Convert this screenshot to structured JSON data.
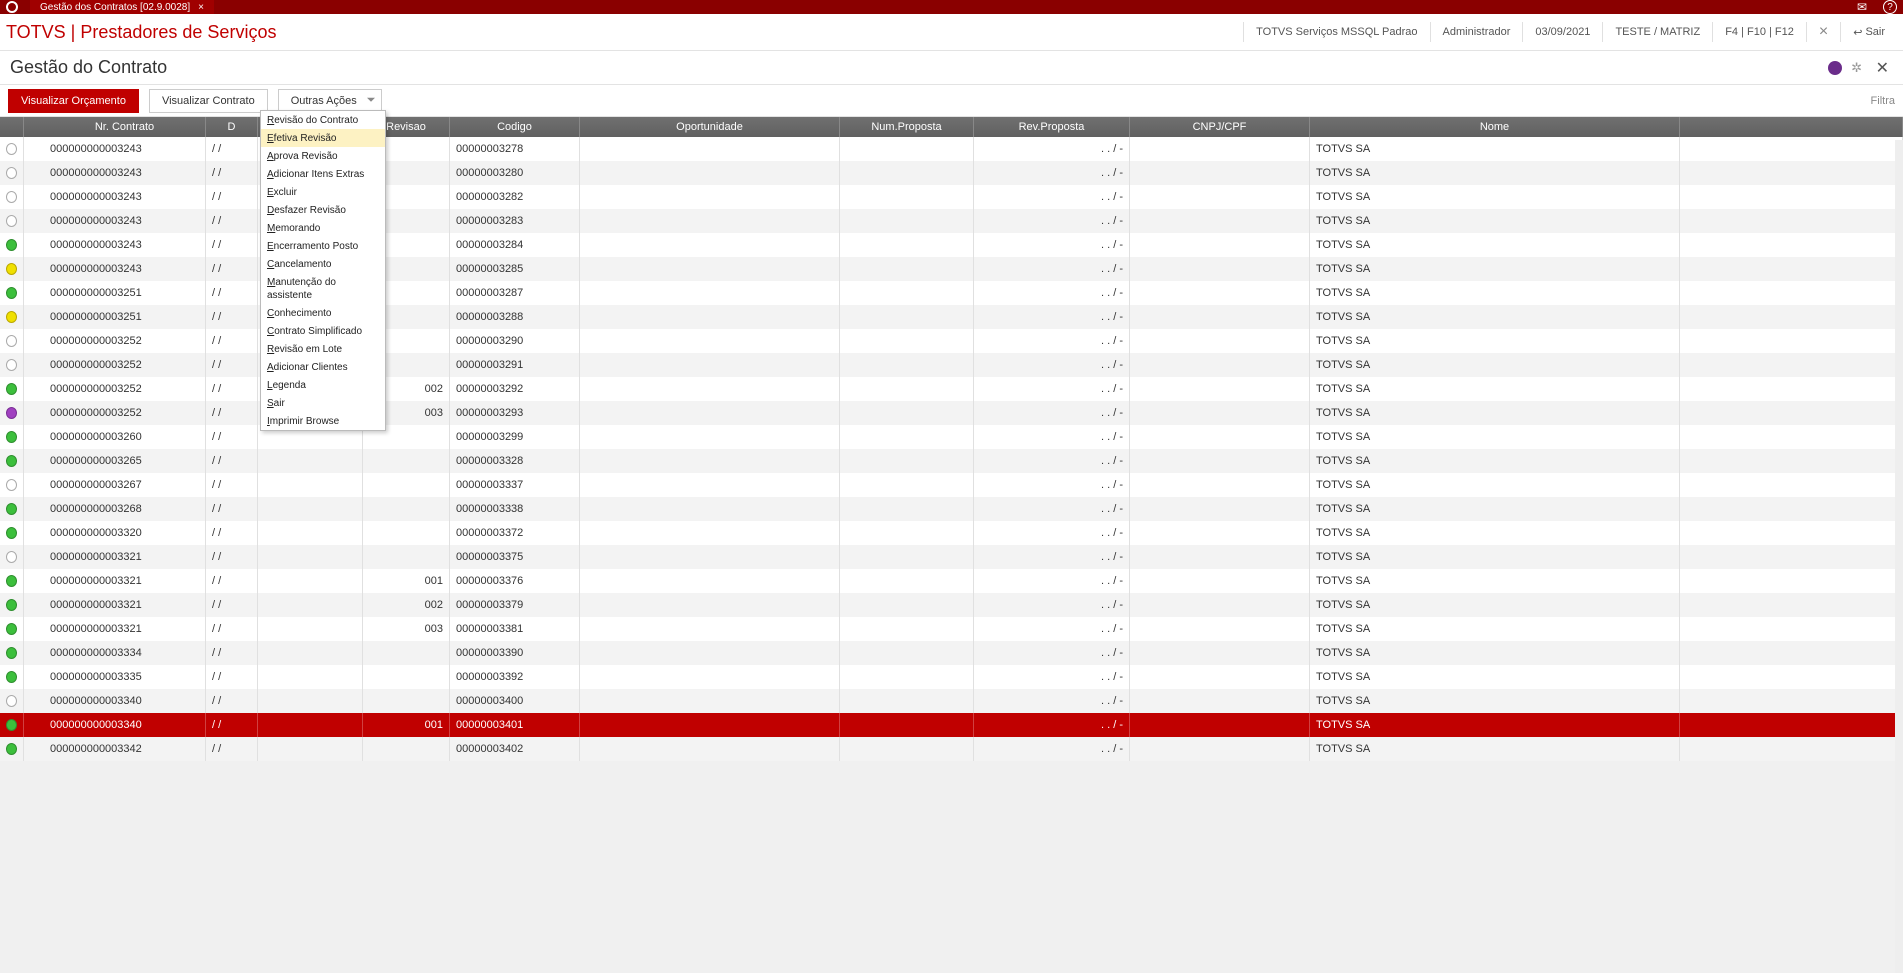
{
  "titlebar": {
    "tab_label": "Gestão dos Contratos [02.9.0028]"
  },
  "header": {
    "brand": "TOTVS | Prestadores de Serviços",
    "env": "TOTVS Serviços MSSQL Padrao",
    "user": "Administrador",
    "date": "03/09/2021",
    "org": "TESTE / MATRIZ",
    "shortcuts": "F4 | F10 | F12",
    "exit": "Sair"
  },
  "page": {
    "title": "Gestão do Contrato"
  },
  "toolbar": {
    "visualizar_orcamento": "Visualizar Orçamento",
    "visualizar_contrato": "Visualizar Contrato",
    "outras_acoes": "Outras Ações",
    "filtrar": "Filtra"
  },
  "dropdown": {
    "items": [
      "Revisão do Contrato",
      "Efetiva Revisão",
      "Aprova Revisão",
      "Adicionar Itens Extras",
      "Excluir",
      "Desfazer Revisão",
      "Memorando",
      "Encerramento Posto",
      "Cancelamento",
      "Manutenção do assistente",
      "Conhecimento",
      "Contrato Simplificado",
      "Revisão em Lote",
      "Adicionar Clientes",
      "Legenda",
      "Sair",
      "Imprimir Browse"
    ],
    "highlight_index": 1
  },
  "columns": {
    "status": "",
    "nr": "Nr. Contrato",
    "dt": "D",
    "rev": "Revisao",
    "cod": "Codigo",
    "opo": "Oportunidade",
    "np": "Num.Proposta",
    "rp": "Rev.Proposta",
    "cnpj": "CNPJ/CPF",
    "nome": "Nome"
  },
  "rows": [
    {
      "st": "white",
      "nr": "000000000003243",
      "dt": "/  /",
      "rev": "",
      "cod": "00000003278",
      "rp": ".  .   /    -",
      "nome": "TOTVS SA"
    },
    {
      "st": "white",
      "nr": "000000000003243",
      "dt": "/  /",
      "rev": "",
      "cod": "00000003280",
      "rp": ".  .   /    -",
      "nome": "TOTVS SA"
    },
    {
      "st": "white",
      "nr": "000000000003243",
      "dt": "/  /",
      "rev": "",
      "cod": "00000003282",
      "rp": ".  .   /    -",
      "nome": "TOTVS SA"
    },
    {
      "st": "white",
      "nr": "000000000003243",
      "dt": "/  /",
      "rev": "",
      "cod": "00000003283",
      "rp": ".  .   /    -",
      "nome": "TOTVS SA"
    },
    {
      "st": "green",
      "nr": "000000000003243",
      "dt": "/  /",
      "rev": "",
      "cod": "00000003284",
      "rp": ".  .   /    -",
      "nome": "TOTVS SA"
    },
    {
      "st": "yellow",
      "nr": "000000000003243",
      "dt": "/  /",
      "rev": "",
      "cod": "00000003285",
      "rp": ".  .   /    -",
      "nome": "TOTVS SA"
    },
    {
      "st": "green",
      "nr": "000000000003251",
      "dt": "/  /",
      "rev": "",
      "cod": "00000003287",
      "rp": ".  .   /    -",
      "nome": "TOTVS SA"
    },
    {
      "st": "yellow",
      "nr": "000000000003251",
      "dt": "/  /",
      "rev": "",
      "cod": "00000003288",
      "rp": ".  .   /    -",
      "nome": "TOTVS SA"
    },
    {
      "st": "white",
      "nr": "000000000003252",
      "dt": "/  /",
      "rev": "",
      "cod": "00000003290",
      "rp": ".  .   /    -",
      "nome": "TOTVS SA"
    },
    {
      "st": "white",
      "nr": "000000000003252",
      "dt": "/  /",
      "rev": "",
      "cod": "00000003291",
      "rp": ".  .   /    -",
      "nome": "TOTVS SA"
    },
    {
      "st": "green",
      "nr": "000000000003252",
      "dt": "/  /",
      "rev": "002",
      "cod": "00000003292",
      "rp": ".  .   /    -",
      "nome": "TOTVS SA"
    },
    {
      "st": "purple",
      "nr": "000000000003252",
      "dt": "/  /",
      "rev": "003",
      "cod": "00000003293",
      "rp": ".  .   /    -",
      "nome": "TOTVS SA"
    },
    {
      "st": "green",
      "nr": "000000000003260",
      "dt": "/  /",
      "rev": "",
      "cod": "00000003299",
      "rp": ".  .   /    -",
      "nome": "TOTVS SA"
    },
    {
      "st": "green",
      "nr": "000000000003265",
      "dt": "/  /",
      "rev": "",
      "cod": "00000003328",
      "rp": ".  .   /    -",
      "nome": "TOTVS SA"
    },
    {
      "st": "white",
      "nr": "000000000003267",
      "dt": "/  /",
      "rev": "",
      "cod": "00000003337",
      "rp": ".  .   /    -",
      "nome": "TOTVS SA"
    },
    {
      "st": "green",
      "nr": "000000000003268",
      "dt": "/  /",
      "rev": "",
      "cod": "00000003338",
      "rp": ".  .   /    -",
      "nome": "TOTVS SA"
    },
    {
      "st": "green",
      "nr": "000000000003320",
      "dt": "/  /",
      "rev": "",
      "cod": "00000003372",
      "rp": ".  .   /    -",
      "nome": "TOTVS SA"
    },
    {
      "st": "white",
      "nr": "000000000003321",
      "dt": "/  /",
      "rev": "",
      "cod": "00000003375",
      "rp": ".  .   /    -",
      "nome": "TOTVS SA"
    },
    {
      "st": "green",
      "nr": "000000000003321",
      "dt": "/  /",
      "rev": "001",
      "cod": "00000003376",
      "rp": ".  .   /    -",
      "nome": "TOTVS SA"
    },
    {
      "st": "green",
      "nr": "000000000003321",
      "dt": "/  /",
      "rev": "002",
      "cod": "00000003379",
      "rp": ".  .   /    -",
      "nome": "TOTVS SA"
    },
    {
      "st": "green",
      "nr": "000000000003321",
      "dt": "/  /",
      "rev": "003",
      "cod": "00000003381",
      "rp": ".  .   /    -",
      "nome": "TOTVS SA"
    },
    {
      "st": "green",
      "nr": "000000000003334",
      "dt": "/  /",
      "rev": "",
      "cod": "00000003390",
      "rp": ".  .   /    -",
      "nome": "TOTVS SA"
    },
    {
      "st": "green",
      "nr": "000000000003335",
      "dt": "/  /",
      "rev": "",
      "cod": "00000003392",
      "rp": ".  .   /    -",
      "nome": "TOTVS SA"
    },
    {
      "st": "white",
      "nr": "000000000003340",
      "dt": "/  /",
      "rev": "",
      "cod": "00000003400",
      "rp": ".  .   /    -",
      "nome": "TOTVS SA"
    },
    {
      "st": "green",
      "nr": "000000000003340",
      "dt": "/  /",
      "rev": "001",
      "cod": "00000003401",
      "rp": ".  .   /    -",
      "nome": "TOTVS SA",
      "selected": true
    },
    {
      "st": "green",
      "nr": "000000000003342",
      "dt": "/  /",
      "rev": "",
      "cod": "00000003402",
      "rp": ".  .   /    -",
      "nome": "TOTVS SA"
    }
  ]
}
